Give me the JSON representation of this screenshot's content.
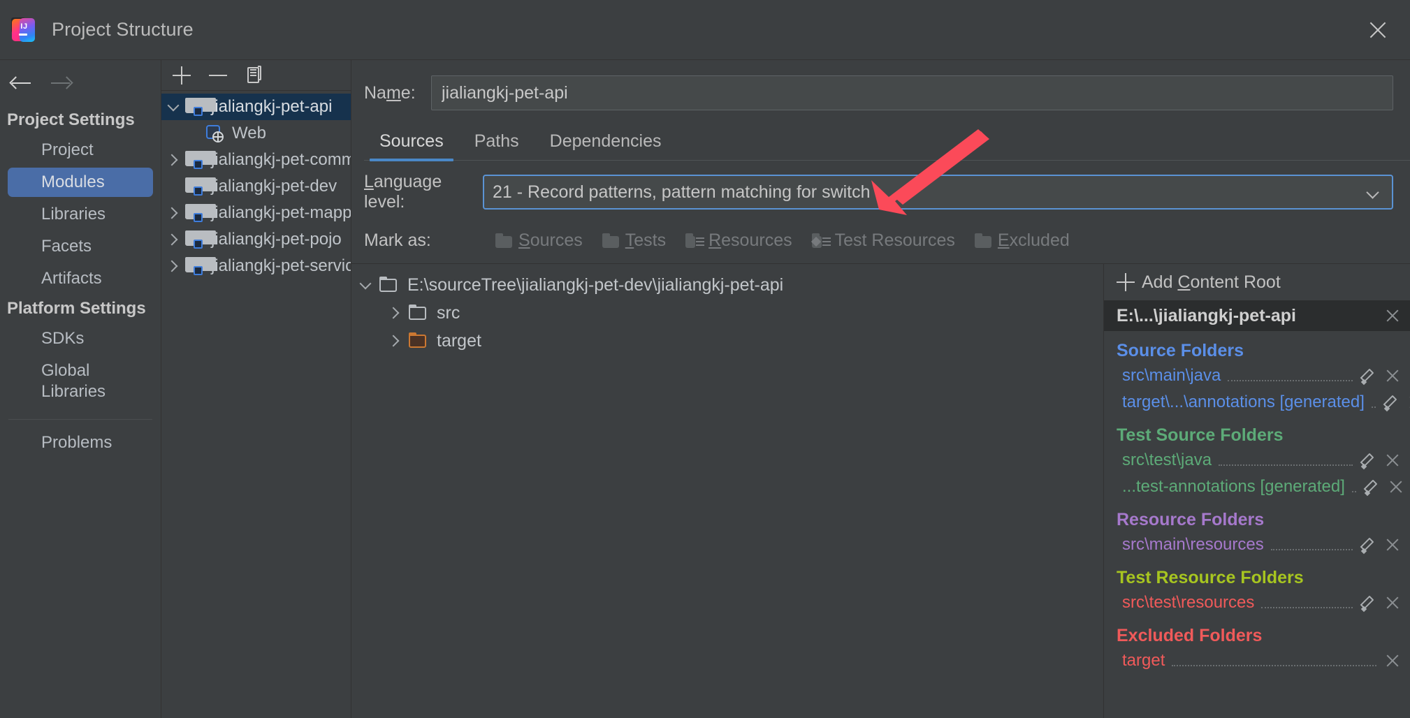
{
  "window": {
    "title": "Project Structure",
    "logo_text": "IJ",
    "close_icon": "close-icon"
  },
  "sidebar": {
    "back_icon": "arrow-left-icon",
    "forward_icon": "arrow-right-icon",
    "groups": [
      {
        "title": "Project Settings",
        "items": [
          {
            "label": "Project",
            "selected": false
          },
          {
            "label": "Modules",
            "selected": true
          },
          {
            "label": "Libraries",
            "selected": false
          },
          {
            "label": "Facets",
            "selected": false
          },
          {
            "label": "Artifacts",
            "selected": false
          }
        ]
      },
      {
        "title": "Platform Settings",
        "items": [
          {
            "label": "SDKs",
            "selected": false
          },
          {
            "label": "Global Libraries",
            "selected": false
          }
        ]
      }
    ],
    "problems_label": "Problems"
  },
  "module_tree": {
    "toolbar": {
      "add_label": "+",
      "remove_label": "—",
      "copy_label": "copy"
    },
    "nodes": [
      {
        "label": "jialiangkj-pet-api",
        "icon": "module-folder-icon",
        "twisty": "expanded",
        "selected": true,
        "indent": 0
      },
      {
        "label": "Web",
        "icon": "web-facet-icon",
        "twisty": "none",
        "selected": false,
        "indent": 1
      },
      {
        "label": "jialiangkj-pet-commo",
        "icon": "module-folder-icon",
        "twisty": "collapsed",
        "selected": false,
        "indent": 0
      },
      {
        "label": "jialiangkj-pet-dev",
        "icon": "module-folder-icon",
        "twisty": "none",
        "selected": false,
        "indent": 0
      },
      {
        "label": "jialiangkj-pet-mapper",
        "icon": "module-folder-icon",
        "twisty": "collapsed",
        "selected": false,
        "indent": 0
      },
      {
        "label": "jialiangkj-pet-pojo",
        "icon": "module-folder-icon",
        "twisty": "collapsed",
        "selected": false,
        "indent": 0
      },
      {
        "label": "jialiangkj-pet-service",
        "icon": "module-folder-icon",
        "twisty": "collapsed",
        "selected": false,
        "indent": 0
      }
    ]
  },
  "module_editor": {
    "name_label": "Na",
    "name_label_mnemonic": "m",
    "name_label_suffix": "e:",
    "name_value": "jialiangkj-pet-api",
    "tabs": [
      {
        "label": "Sources",
        "active": true
      },
      {
        "label": "Paths",
        "active": false
      },
      {
        "label": "Dependencies",
        "active": false
      }
    ],
    "language_level": {
      "label_mnemonic": "L",
      "label_rest": "anguage level:",
      "value": "21 - Record patterns, pattern matching for switch",
      "chevron_icon": "chevron-down-icon",
      "focus_color": "#5a93d4"
    },
    "mark_as": {
      "label": "Mark as:",
      "buttons": [
        {
          "pre": "",
          "mnemonic": "S",
          "post": "ources",
          "icon": "sources-folder-icon"
        },
        {
          "pre": "",
          "mnemonic": "T",
          "post": "ests",
          "icon": "tests-folder-icon"
        },
        {
          "pre": "",
          "mnemonic": "R",
          "post": "esources",
          "icon": "resources-folder-icon"
        },
        {
          "pre": "",
          "mnemonic": "",
          "post": "Test Resources",
          "icon": "test-resources-folder-icon"
        },
        {
          "pre": "",
          "mnemonic": "E",
          "post": "xcluded",
          "icon": "excluded-folder-icon"
        }
      ]
    }
  },
  "content_root_tree": {
    "nodes": [
      {
        "label": "E:\\sourceTree\\jialiangkj-pet-dev\\jialiangkj-pet-api",
        "twisty": "expanded",
        "indent": 0,
        "icon": "folder-icon",
        "excluded": false
      },
      {
        "label": "src",
        "twisty": "collapsed",
        "indent": 1,
        "icon": "folder-icon",
        "excluded": false
      },
      {
        "label": "target",
        "twisty": "collapsed",
        "indent": 1,
        "icon": "folder-icon-excluded",
        "excluded": true
      }
    ]
  },
  "folders_pane": {
    "add_content_root": {
      "pre": "Add ",
      "mnemonic": "C",
      "post": "ontent Root",
      "icon": "plus-icon"
    },
    "content_root": {
      "path": "E:\\...\\jialiangkj-pet-api",
      "remove_icon": "close-icon"
    },
    "groups": [
      {
        "title": "Source Folders",
        "color": "#5b8fe8",
        "rows": [
          {
            "name": "src\\main\\java",
            "color": "#5b8fe8",
            "has_edit": true,
            "has_remove": true
          },
          {
            "name": "target\\...\\annotations [generated]",
            "color": "#5b8fe8",
            "has_edit": true,
            "has_remove": true
          }
        ]
      },
      {
        "title": "Test Source Folders",
        "color": "#5dab78",
        "rows": [
          {
            "name": "src\\test\\java",
            "color": "#5dab78",
            "has_edit": true,
            "has_remove": true
          },
          {
            "name": "...test-annotations [generated]",
            "color": "#5dab78",
            "has_edit": true,
            "has_remove": true
          }
        ]
      },
      {
        "title": "Resource Folders",
        "color": "#a679cc",
        "rows": [
          {
            "name": "src\\main\\resources",
            "color": "#a679cc",
            "has_edit": true,
            "has_remove": true
          }
        ]
      },
      {
        "title": "Test Resource Folders",
        "color": "#a7c520",
        "rows": [
          {
            "name": "src\\test\\resources",
            "color": "#f05a5a",
            "has_edit": true,
            "has_remove": true
          }
        ]
      },
      {
        "title": "Excluded Folders",
        "color": "#f05a5a",
        "rows": [
          {
            "name": "target",
            "color": "#f05a5a",
            "has_edit": false,
            "has_remove": true
          }
        ]
      }
    ]
  },
  "annotation": {
    "arrow_color": "#fb4a59",
    "points_to": "language-level-combo"
  }
}
